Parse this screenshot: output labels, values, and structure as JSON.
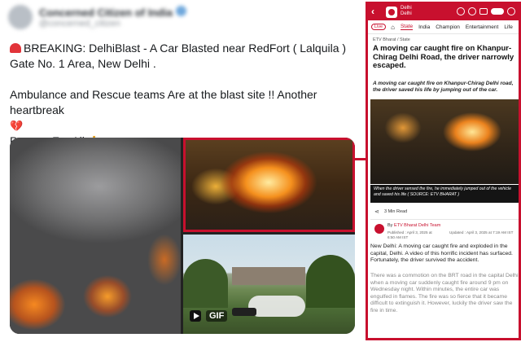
{
  "post": {
    "author_name": "Concerned Citizen of India",
    "author_handle": "@concerned_citizen",
    "line1": "BREAKING: DelhiBlast - A Car Blasted near RedFort ( Lalquila ) Gate No. 1 Area,  New Delhi .",
    "line2": "Ambulance and Rescue teams Are at the blast site !! Another heartbreak",
    "line3": "Prayers For All",
    "emoji_heart": "💔",
    "emoji_hands": "🙏",
    "gif_label": "GIF"
  },
  "article": {
    "edition": [
      "Delhi",
      "Delhi"
    ],
    "live_label": "Live",
    "nav": [
      "State",
      "India",
      "Champion",
      "Entertainment",
      "Life"
    ],
    "active_tab": "State",
    "breadcrumb": "ETV Bharat  /  State",
    "headline": "A moving car caught fire on Khanpur-Chirag Delhi Road, the driver narrowly escaped.",
    "subhead": "A moving car caught fire on Khanpur-Chirag Delhi road, the driver saved his life by jumping out of the car.",
    "caption": "When the driver sensed the fire, he immediately jumped out of the vehicle and saved his life ( SOURCE: ETV BHARAT )",
    "read_time": "3 Min Read",
    "byline_prefix": "By",
    "byline_author": "ETV Bharat Delhi Team",
    "published": "Published : April 3, 2025 at 6:50 AM IST",
    "updated": "Updated : April 3, 2025 at 7:19 AM IST",
    "body1": "New Delhi: A moving car caught fire and exploded in the capital, Delhi. A video of this horrific incident has surfaced. Fortunately, the driver survived the accident.",
    "body2": "There was a commotion on the BRT road in the capital Delhi when a moving car suddenly caught fire around 9 pm on Wednesday night. Within minutes, the entire car was engulfed in flames. The fire was so fierce that it became difficult to extinguish it. However, luckily the driver saw the fire in time."
  },
  "colors": {
    "accent": "#c8102e",
    "text": "#16191c"
  }
}
